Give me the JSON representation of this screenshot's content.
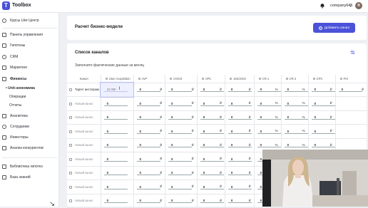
{
  "app": {
    "title": "Toolbox",
    "logo_letter": "T",
    "account": "company645"
  },
  "sidebar": {
    "course": "Курсы Like Центр",
    "items": [
      "Панель управления",
      "Гипотезы",
      "CRM",
      "Маркетинг",
      "Финансы"
    ],
    "finance_sub": [
      "Unit-экономика",
      "Операции",
      "Отчеты"
    ],
    "items2": [
      "Аналитика",
      "Сотрудники",
      "Инвесторы",
      "Анализ конкурентов"
    ],
    "items3": [
      "Библиотека гипотез",
      "База знаний"
    ]
  },
  "model": {
    "title": "Расчет бизнес-модели",
    "add_label": "Добавить канал"
  },
  "channels": {
    "title": "Список каналов",
    "subtitle": "Заполните фактические данные за месяц",
    "headers": [
      "Канал",
      "User Acquisition",
      "AvP",
      "COGS",
      "APC",
      "1stCOGS",
      "CR 1",
      "CR 2",
      "CPC",
      "FIX"
    ],
    "rows": [
      {
        "name": "Таргет инстаграм",
        "ua": "15 000",
        "avp": "0",
        "cogs": "0",
        "apc": "0",
        "first": "0",
        "cr1": "0",
        "cr2": "0",
        "cpc": "0",
        "fix": "0"
      },
      {
        "name": "Новый канал",
        "ua": "0",
        "avp": "0",
        "cogs": "0",
        "apc": "0",
        "first": "0",
        "cr1": "0",
        "cr2": "0",
        "cpc": "0",
        "fix": ""
      },
      {
        "name": "Новый канал",
        "ua": "0",
        "avp": "0",
        "cogs": "0",
        "apc": "0",
        "first": "0",
        "cr1": "0",
        "cr2": "0",
        "cpc": "0",
        "fix": ""
      },
      {
        "name": "Новый канал",
        "ua": "0",
        "avp": "0",
        "cogs": "0",
        "apc": "0",
        "first": "0",
        "cr1": "0",
        "cr2": "0",
        "cpc": "0",
        "fix": ""
      },
      {
        "name": "Новый канал",
        "ua": "0",
        "avp": "0",
        "cogs": "0",
        "apc": "0",
        "first": "0",
        "cr1": "0",
        "cr2": "0",
        "cpc": "0",
        "fix": ""
      },
      {
        "name": "Новый канал",
        "ua": "0",
        "avp": "0",
        "cogs": "0",
        "apc": "0",
        "first": "0",
        "cr1": "0",
        "cr2": "0",
        "cpc": "0",
        "fix": ""
      },
      {
        "name": "Новый канал",
        "ua": "0",
        "avp": "0",
        "cogs": "0",
        "apc": "0",
        "first": "0",
        "cr1": "0",
        "cr2": "0",
        "cpc": "0",
        "fix": ""
      },
      {
        "name": "Новый канал",
        "ua": "0",
        "avp": "0",
        "cogs": "0",
        "apc": "0",
        "first": "0",
        "cr1": "0",
        "cr2": "0",
        "cpc": "0",
        "fix": ""
      },
      {
        "name": "Новый канал",
        "ua": "0",
        "avp": "0",
        "cogs": "0",
        "apc": "0",
        "first": "0",
        "cr1": "0",
        "cr2": "0",
        "cpc": "0",
        "fix": ""
      }
    ],
    "currency": "₽",
    "percent": "%"
  }
}
